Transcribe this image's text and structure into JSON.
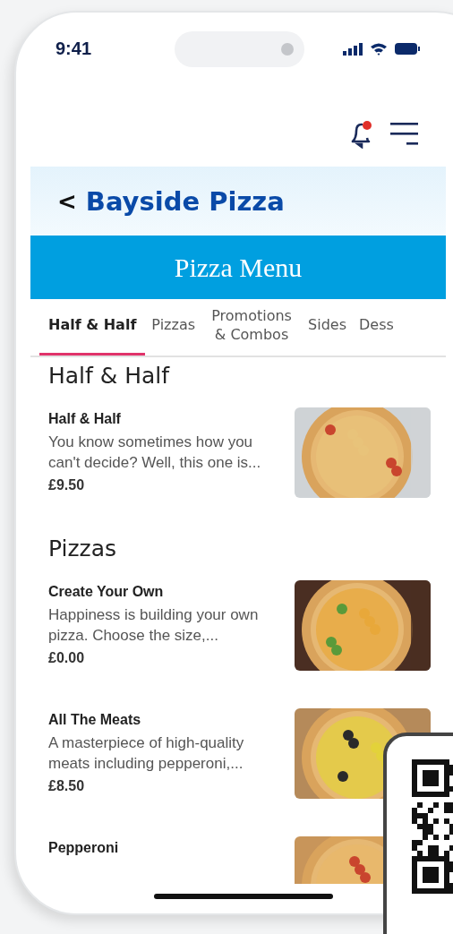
{
  "status_bar": {
    "time": "9:41"
  },
  "header": {
    "back": "<",
    "title": "Bayside Pizza"
  },
  "banner": {
    "title": "Pizza Menu"
  },
  "tabs": [
    {
      "label": "Half & Half",
      "selected": true
    },
    {
      "label": "Pizzas",
      "selected": false
    },
    {
      "label": "Promotions & Combos",
      "selected": false
    },
    {
      "label": "Sides",
      "selected": false
    },
    {
      "label": "Dess",
      "selected": false
    }
  ],
  "sections": [
    {
      "title": "Half & Half",
      "items": [
        {
          "name": "Half & Half",
          "description": "You know sometimes how you can't decide? Well, this one is...",
          "price": "£9.50"
        }
      ]
    },
    {
      "title": "Pizzas",
      "items": [
        {
          "name": "Create Your Own",
          "description": "Happiness is building your own pizza. Choose the size,...",
          "price": "£0.00"
        },
        {
          "name": "All The Meats",
          "description": "A masterpiece of high-quality meats including pepperoni,...",
          "price": "£8.50"
        },
        {
          "name": "Pepperoni"
        }
      ]
    }
  ]
}
